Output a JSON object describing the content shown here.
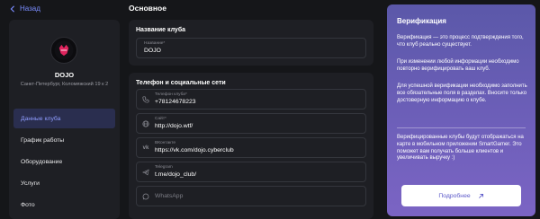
{
  "back": {
    "label": "Назад",
    "icon": "arrow-left-icon"
  },
  "sidebar": {
    "logo_icon": "dojo-logo",
    "club_name": "DOJO",
    "club_address": "Санкт-Петербург, Коломяжский 19 к 2",
    "items": [
      {
        "label": "Данные клуба",
        "active": true
      },
      {
        "label": "График работы",
        "active": false
      },
      {
        "label": "Оборудование",
        "active": false
      },
      {
        "label": "Услуги",
        "active": false
      },
      {
        "label": "Фото",
        "active": false
      }
    ]
  },
  "main": {
    "section_title": "Основное",
    "club_name_card": {
      "title": "Название клуба",
      "name_field": {
        "label": "Название*",
        "value": "DOJO"
      }
    },
    "contacts_card": {
      "title": "Телефон и социальные сети",
      "phone": {
        "icon": "phone-icon",
        "label": "Телефон клуба*",
        "value": "+78124678223"
      },
      "site": {
        "icon": "globe-icon",
        "label": "Сайт*",
        "value": "http://dojo.wtf/"
      },
      "vk": {
        "icon": "vk-icon",
        "label": "ВКонтакте",
        "value": "https://vk.com/dojo.cyberclub"
      },
      "telegram": {
        "icon": "telegram-icon",
        "label": "Telegram",
        "value": "t.me/dojo_club/"
      },
      "whatsapp": {
        "icon": "whatsapp-icon",
        "placeholder": "WhatsApp"
      }
    }
  },
  "verification": {
    "title": "Верификация",
    "p1": "Верификация — это процесс подтверждения того, что клуб реально существует.",
    "p2": "При изменении любой информации необходимо повторно верифицировать ваш клуб.",
    "p3": "Для успешной верификации необходимо заполнить все обязательные поля в разделах. Вносите только достоверную информацию о клубе.",
    "p4": "Верифицированные клубы будут отображаться на карте в мобильном приложении SmartGamer. Это поможет вам получать больше клиентов и увеличивать выручку :)",
    "button_label": "Подробнее",
    "button_icon": "arrow-up-right-icon",
    "colors": {
      "gradient_top": "#5b58a9",
      "gradient_bottom": "#7b64c4",
      "accent": "#7a8cff"
    }
  }
}
